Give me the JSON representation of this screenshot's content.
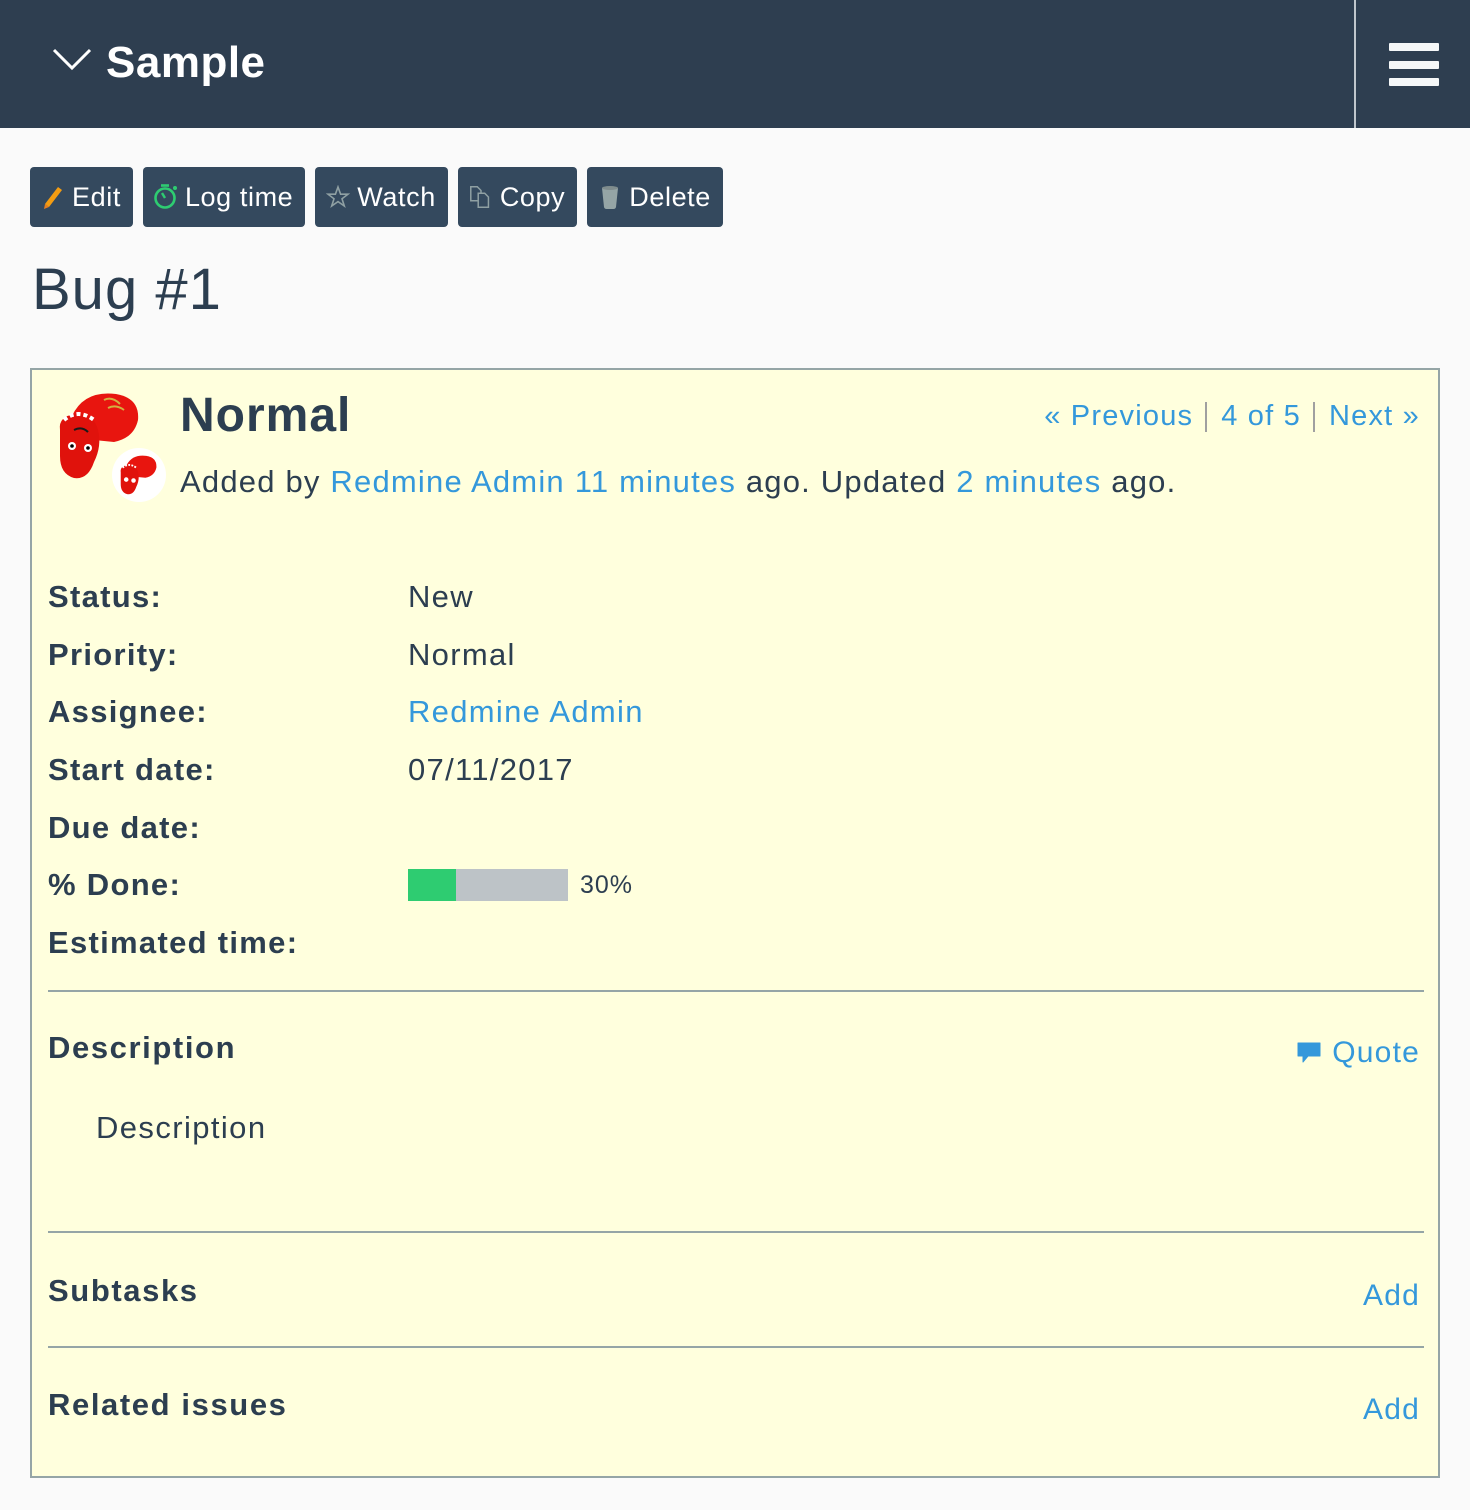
{
  "header": {
    "project_name": "Sample",
    "expand_icon": "chevron-down-icon",
    "menu_icon": "hamburger-menu-icon"
  },
  "toolbar": {
    "buttons": [
      {
        "label": "Edit",
        "icon": "pencil-icon",
        "icon_color": "#f39c12"
      },
      {
        "label": "Log time",
        "icon": "stopwatch-icon",
        "icon_color": "#2ecc71"
      },
      {
        "label": "Watch",
        "icon": "star-outline-icon",
        "icon_color": "#95a5a6"
      },
      {
        "label": "Copy",
        "icon": "copy-icon",
        "icon_color": "#95a5a6"
      },
      {
        "label": "Delete",
        "icon": "trash-icon",
        "icon_color": "#95a5a6"
      }
    ]
  },
  "page": {
    "title": "Bug #1"
  },
  "issue": {
    "subject": "Normal",
    "author_prefix": "Added by",
    "author": "Redmine Admin",
    "created_ago": "11 minutes",
    "mid_text": "ago. Updated",
    "updated_ago": "2 minutes",
    "suffix_text": "ago.",
    "navigation": {
      "previous": "« Previous",
      "position": "4 of 5",
      "next": "Next »"
    },
    "attributes": [
      {
        "label": "Status:",
        "value": "New"
      },
      {
        "label": "Priority:",
        "value": "Normal"
      },
      {
        "label": "Assignee:",
        "value": "Redmine Admin",
        "is_link": true
      },
      {
        "label": "Start date:",
        "value": "07/11/2017"
      },
      {
        "label": "Due date:",
        "value": ""
      },
      {
        "label": "% Done:",
        "value": "30%",
        "progress_percent": 30
      },
      {
        "label": "Estimated time:",
        "value": ""
      }
    ],
    "description": {
      "title": "Description",
      "quote_label": "Quote",
      "quote_icon": "speech-bubble-icon",
      "text": "Description"
    },
    "subtasks": {
      "title": "Subtasks",
      "add_label": "Add"
    },
    "related": {
      "title": "Related issues",
      "add_label": "Add"
    }
  },
  "colors": {
    "header_bg": "#2e3e50",
    "button_bg": "#34495e",
    "link": "#3498db",
    "issue_bg": "#ffffdd",
    "progress_done": "#2ecc71",
    "progress_todo": "#bdc3c7",
    "text": "#2c3e50"
  }
}
